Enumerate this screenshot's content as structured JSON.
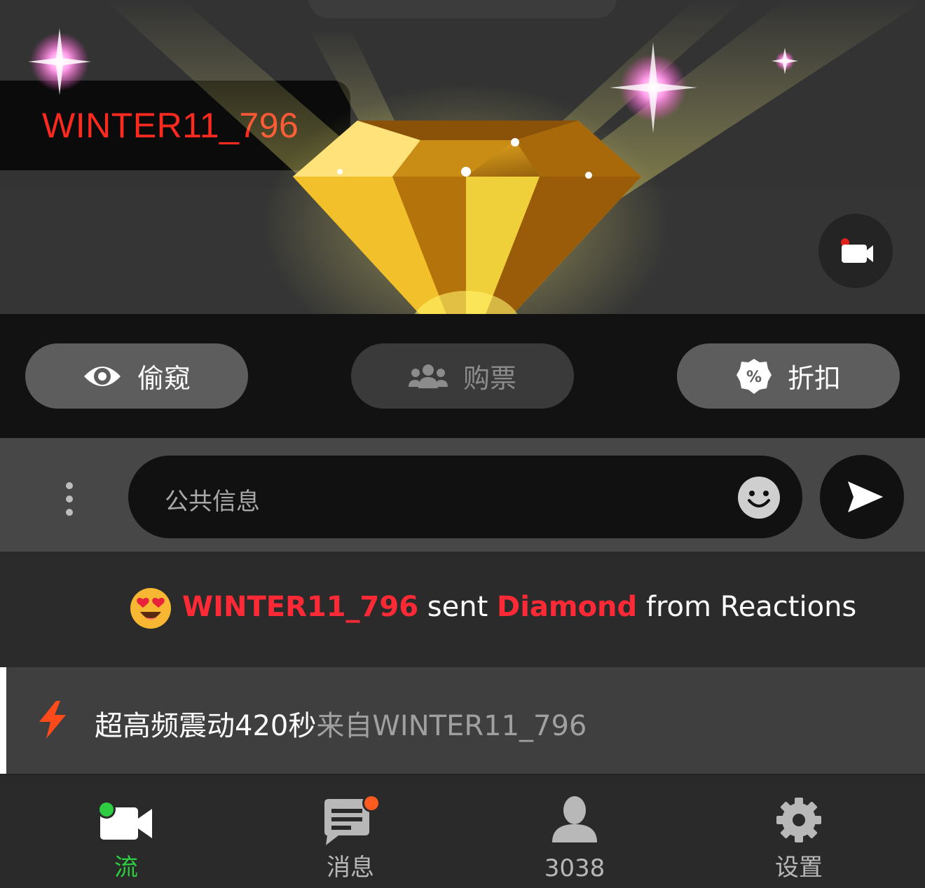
{
  "overlay": {
    "streamer_name": "WINTER11_796"
  },
  "actions": {
    "peek_label": "偷窥",
    "vote_label": "购票",
    "discount_label": "折扣"
  },
  "chat": {
    "placeholder": "公共信息"
  },
  "feed": {
    "gift": {
      "user": "WINTER11_796",
      "sent": "sent",
      "item": "Diamond",
      "from": "from Reactions"
    },
    "vibration": {
      "main": "超高频震动420秒",
      "sub": "来自WINTER11_796"
    }
  },
  "nav": {
    "stream_label": "流",
    "messages_label": "消息",
    "count_label": "3038",
    "settings_label": "设置"
  },
  "colors": {
    "accent_green": "#2ecc40",
    "brand_red": "#ff2a1f",
    "badge_orange": "#ff5a1f",
    "bolt_orange": "#ff4a1a"
  }
}
